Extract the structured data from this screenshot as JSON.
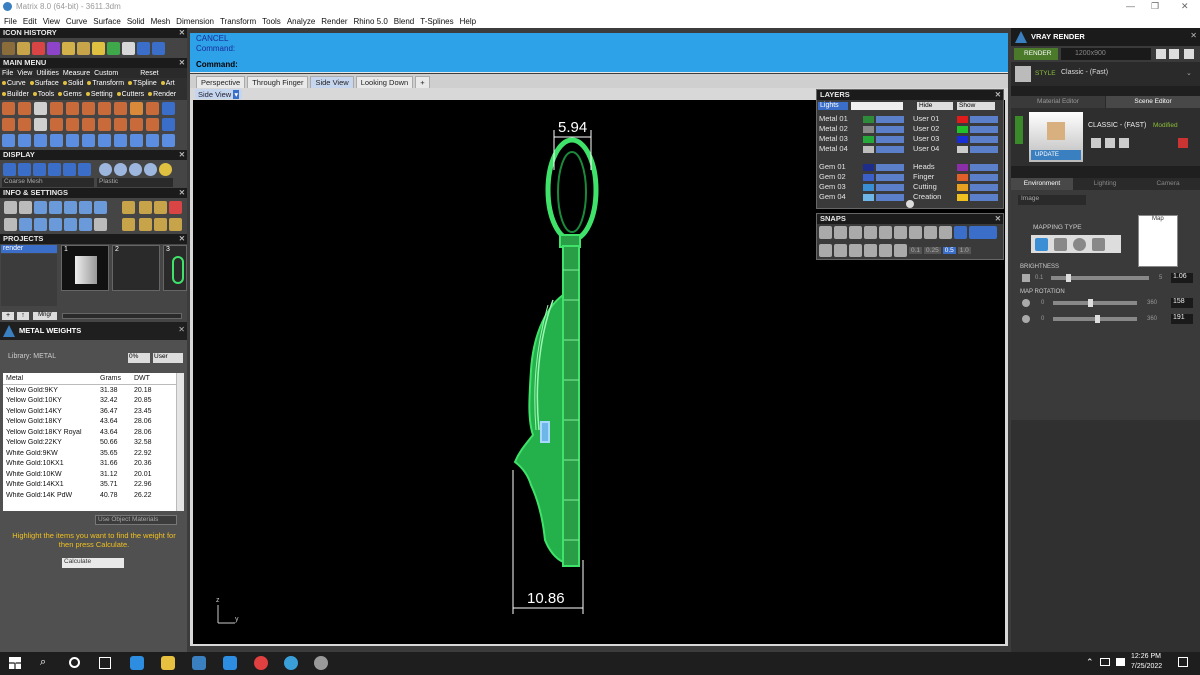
{
  "window": {
    "title": "Matrix 8.0 (64-bit) - 3611.3dm",
    "minimize": "—",
    "maximize": "❐",
    "close": "✕"
  },
  "menubar": [
    "File",
    "Edit",
    "View",
    "Curve",
    "Surface",
    "Solid",
    "Mesh",
    "Dimension",
    "Transform",
    "Tools",
    "Analyze",
    "Render",
    "Rhino 5.0",
    "Blend",
    "T-Splines",
    "Help"
  ],
  "left": {
    "icon_history": "ICON HISTORY",
    "main_menu": "MAIN MENU",
    "main_menu_row1": [
      "File",
      "View",
      "Utilities",
      "Measure",
      "Custom",
      "Reset"
    ],
    "main_menu_row2": [
      "Curve",
      "Surface",
      "Solid",
      "Transform",
      "TSpline",
      "Art"
    ],
    "main_menu_row3": [
      "Builder",
      "Tools",
      "Gems",
      "Setting",
      "Cutters",
      "Render"
    ],
    "display": "DISPLAY",
    "display_mode": "Coarse Mesh",
    "display_material": "Plastic",
    "info_settings": "INFO & SETTINGS",
    "projects": "PROJECTS",
    "project_name": "render",
    "thumbs": [
      "1",
      "2",
      "3"
    ],
    "project_buttons": [
      "+",
      "↑",
      "Mngr"
    ],
    "metal_weights": "METAL WEIGHTS",
    "library": "Library: METAL",
    "lib_buttons": [
      "0%",
      "User"
    ],
    "table_headers": [
      "Metal",
      "Grams",
      "DWT"
    ],
    "table_rows": [
      [
        "Yellow Gold:9KY",
        "31.38",
        "20.18"
      ],
      [
        "Yellow Gold:10KY",
        "32.42",
        "20.85"
      ],
      [
        "Yellow Gold:14KY",
        "36.47",
        "23.45"
      ],
      [
        "Yellow Gold:18KY",
        "43.64",
        "28.06"
      ],
      [
        "Yellow Gold:18KY Royal",
        "43.64",
        "28.06"
      ],
      [
        "Yellow Gold:22KY",
        "50.66",
        "32.58"
      ],
      [
        "White Gold:9KW",
        "35.65",
        "22.92"
      ],
      [
        "White Gold:10KX1",
        "31.66",
        "20.36"
      ],
      [
        "White Gold:10KW",
        "31.12",
        "20.01"
      ],
      [
        "White Gold:14KX1",
        "35.71",
        "22.96"
      ],
      [
        "White Gold:14K PdW",
        "40.78",
        "26.22"
      ]
    ],
    "use_object_materials": "Use Object Materials",
    "hint": "Highlight the items you want to find the weight for then press Calculate.",
    "calculate": "Calculate"
  },
  "command": {
    "cancel": "CANCEL",
    "line1": "Command:",
    "prompt": "Command:"
  },
  "tabs": [
    "Perspective",
    "Through Finger",
    "Side View",
    "Looking Down",
    "+"
  ],
  "viewport": {
    "label": "Side View",
    "dim_top": "5.94",
    "dim_bottom": "10.86",
    "axis_z": "z",
    "axis_y": "y"
  },
  "layers": {
    "title": "LAYERS",
    "lights": "Lights",
    "hide": "Hide",
    "show": "Show",
    "left": [
      {
        "name": "Metal 01",
        "color": "#2e8b3a"
      },
      {
        "name": "Metal 02",
        "color": "#8a8a8a"
      },
      {
        "name": "Metal 03",
        "color": "#26a83a"
      },
      {
        "name": "Metal 04",
        "color": "#bdbdbd"
      },
      {
        "name": "Gem 01",
        "color": "#1f2d8a"
      },
      {
        "name": "Gem 02",
        "color": "#3b60c9"
      },
      {
        "name": "Gem 03",
        "color": "#3a8fd4"
      },
      {
        "name": "Gem 04",
        "color": "#6fb6e8"
      }
    ],
    "right": [
      {
        "name": "User 01",
        "color": "#e01b1b"
      },
      {
        "name": "User 02",
        "color": "#22c12c"
      },
      {
        "name": "User 03",
        "color": "#1a2ed6"
      },
      {
        "name": "User 04",
        "color": "#cccccc"
      },
      {
        "name": "Heads",
        "color": "#8a2fa8"
      },
      {
        "name": "Finger",
        "color": "#e0602a"
      },
      {
        "name": "Cutting",
        "color": "#e8a020"
      },
      {
        "name": "Creation",
        "color": "#f0c020"
      }
    ]
  },
  "snaps": {
    "title": "SNAPS",
    "values": [
      "0.1",
      "0.25",
      "0.5",
      "1.0"
    ]
  },
  "vray": {
    "title": "VRAY RENDER",
    "render_btn": "RENDER",
    "resolution": "1200x900",
    "style_label": "STYLE",
    "style_value": "Classic - (Fast)",
    "tab_material": "Material Editor",
    "tab_scene": "Scene Editor",
    "preset": "CLASSIC - (FAST)",
    "modified": "Modified",
    "update": "UPDATE",
    "env_tabs": [
      "Environment",
      "Lighting",
      "Camera"
    ],
    "env_select": "Image",
    "mapping_type": "MAPPING TYPE",
    "map": "Map",
    "brightness": "BRIGHTNESS",
    "bright_min": "0.1",
    "bright_max": "5",
    "bright_val": "1.06",
    "map_rotation": "MAP ROTATION",
    "rot_min": "0",
    "rot_max": "360",
    "rot1_val": "158",
    "rot2_val": "191"
  },
  "taskbar": {
    "time": "12:26 PM",
    "date": "7/25/2022"
  },
  "colors": {
    "model_green": "#3fe36a",
    "panel_bg": "#505050",
    "header_bg": "#1b1b1b",
    "accent_blue": "#3a7fc0"
  }
}
